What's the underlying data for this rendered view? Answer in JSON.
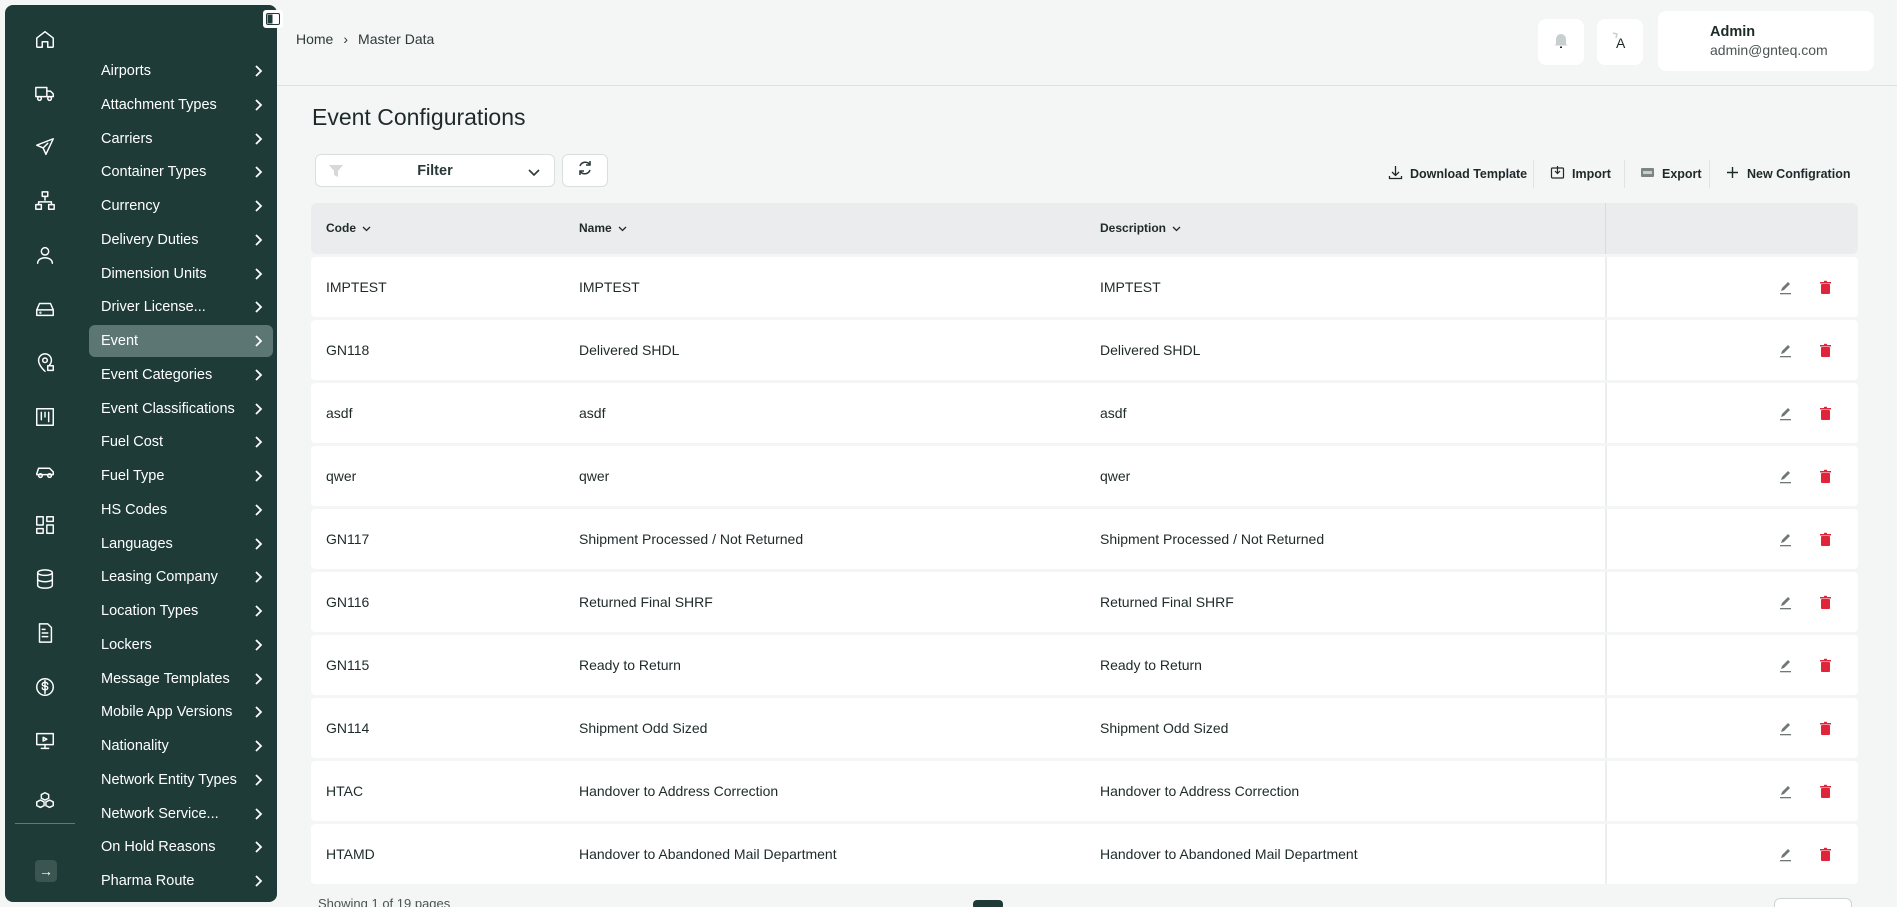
{
  "sidebar": {
    "rail_icons": [
      "home-icon",
      "truck-icon",
      "plane-icon",
      "sitemap-icon",
      "user-icon",
      "inbox-icon",
      "map-pin-icon",
      "kanban-icon",
      "car-icon",
      "dashboard-icon",
      "database-icon",
      "document-icon",
      "dollar-icon",
      "monitor-icon",
      "cubes-icon"
    ],
    "items": [
      {
        "label": "Airports"
      },
      {
        "label": "Attachment Types"
      },
      {
        "label": "Carriers"
      },
      {
        "label": "Container Types"
      },
      {
        "label": "Currency"
      },
      {
        "label": "Delivery Duties"
      },
      {
        "label": "Dimension Units"
      },
      {
        "label": "Driver License..."
      },
      {
        "label": "Event",
        "active": true
      },
      {
        "label": "Event Categories"
      },
      {
        "label": "Event Classifications"
      },
      {
        "label": "Fuel Cost"
      },
      {
        "label": "Fuel Type"
      },
      {
        "label": "HS Codes"
      },
      {
        "label": "Languages"
      },
      {
        "label": "Leasing Company"
      },
      {
        "label": "Location Types"
      },
      {
        "label": "Lockers"
      },
      {
        "label": "Message Templates"
      },
      {
        "label": "Mobile App Versions"
      },
      {
        "label": "Nationality"
      },
      {
        "label": "Network Entity Types"
      },
      {
        "label": "Network Service..."
      },
      {
        "label": "On Hold Reasons"
      },
      {
        "label": "Pharma Route"
      }
    ]
  },
  "header": {
    "breadcrumb": [
      "Home",
      "Master Data"
    ],
    "user": {
      "name": "Admin",
      "email": "admin@gnteq.com"
    }
  },
  "main": {
    "title": "Event Configurations",
    "filter_label": "Filter",
    "toolbar": {
      "download_template": "Download Template",
      "import": "Import",
      "export": "Export",
      "new_config": "New Configration"
    },
    "columns": [
      "Code",
      "Name",
      "Description"
    ],
    "rows": [
      {
        "code": "IMPTEST",
        "name": "IMPTEST",
        "description": "IMPTEST"
      },
      {
        "code": "GN118",
        "name": "Delivered SHDL",
        "description": "Delivered SHDL"
      },
      {
        "code": "asdf",
        "name": "asdf",
        "description": "asdf"
      },
      {
        "code": "qwer",
        "name": "qwer",
        "description": "qwer"
      },
      {
        "code": "GN117",
        "name": "Shipment Processed / Not Returned",
        "description": "Shipment Processed / Not Returned"
      },
      {
        "code": "GN116",
        "name": "Returned Final SHRF",
        "description": "Returned Final SHRF"
      },
      {
        "code": "GN115",
        "name": "Ready to Return",
        "description": "Ready to Return"
      },
      {
        "code": "GN114",
        "name": "Shipment Odd Sized",
        "description": "Shipment Odd Sized"
      },
      {
        "code": "HTAC",
        "name": "Handover to Address Correction",
        "description": "Handover to Address Correction"
      },
      {
        "code": "HTAMD",
        "name": "Handover to Abandoned Mail Department",
        "description": "Handover to Abandoned Mail Department"
      }
    ],
    "footer": {
      "showing": "Showing 1 of 19 pages"
    }
  },
  "colors": {
    "sidebar": "#1e3b37",
    "active_item": "#5c7673",
    "delete": "#e0243a"
  }
}
